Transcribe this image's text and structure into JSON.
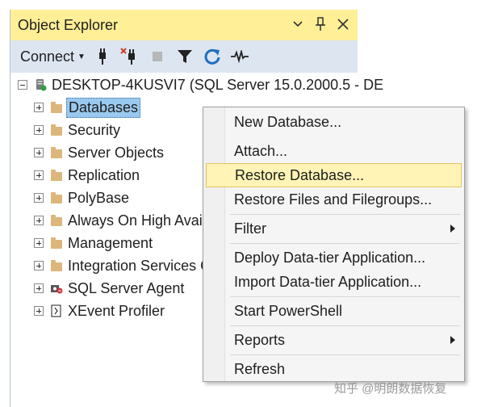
{
  "panel": {
    "title": "Object Explorer",
    "title_buttons": [
      "chevron-down-icon",
      "pin-icon",
      "close-icon"
    ]
  },
  "toolbar": {
    "connect_label": "Connect",
    "icons": [
      "connect-plug-icon",
      "disconnect-icon",
      "stop-icon",
      "filter-icon",
      "refresh-icon",
      "activity-monitor-icon"
    ]
  },
  "tree": {
    "server": "DESKTOP-4KUSVI7 (SQL Server 15.0.2000.5 - DE",
    "nodes": [
      {
        "label": "Databases",
        "icon": "folder-icon",
        "selected": true
      },
      {
        "label": "Security",
        "icon": "folder-icon"
      },
      {
        "label": "Server Objects",
        "icon": "folder-icon"
      },
      {
        "label": "Replication",
        "icon": "folder-icon"
      },
      {
        "label": "PolyBase",
        "icon": "folder-icon"
      },
      {
        "label": "Always On High Availa",
        "icon": "folder-icon"
      },
      {
        "label": "Management",
        "icon": "folder-icon"
      },
      {
        "label": "Integration Services Ca",
        "icon": "folder-icon"
      },
      {
        "label": "SQL Server Agent",
        "icon": "agent-icon"
      },
      {
        "label": "XEvent Profiler",
        "icon": "xevent-icon"
      }
    ]
  },
  "context_menu": {
    "items": [
      {
        "label": "New Database..."
      },
      {
        "label": "Attach..."
      },
      {
        "label": "Restore Database...",
        "highlighted": true
      },
      {
        "label": "Restore Files and Filegroups..."
      },
      {
        "label": "Filter",
        "submenu": true
      },
      {
        "label": "Deploy Data-tier Application..."
      },
      {
        "label": "Import Data-tier Application..."
      },
      {
        "label": "Start PowerShell"
      },
      {
        "label": "Reports",
        "submenu": true
      },
      {
        "label": "Refresh"
      }
    ]
  },
  "watermark": "知乎 @明朗数据恢复",
  "colors": {
    "titlebar": "#ffef97",
    "toolbar": "#dde5f1",
    "selection": "#99c9ef",
    "menu_highlight": "#fff4b5"
  }
}
